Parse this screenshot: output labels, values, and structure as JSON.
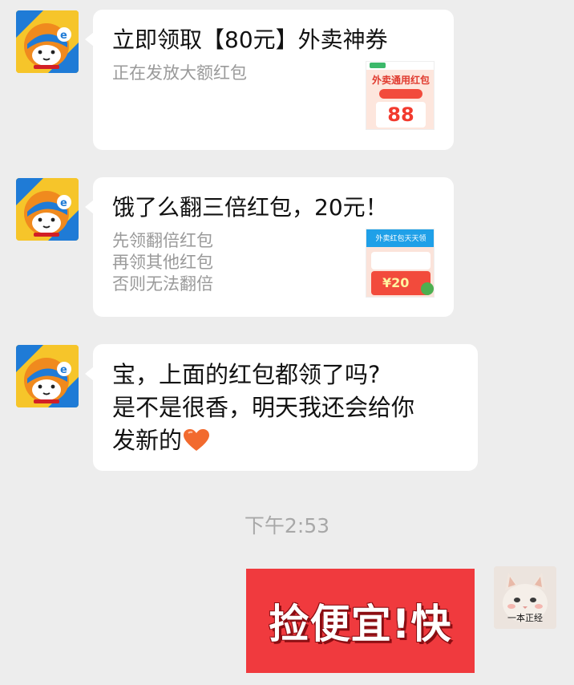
{
  "messages": [
    {
      "type": "card",
      "title": "立即领取【80元】外卖神券",
      "desc_lines": [
        "正在发放大额红包"
      ],
      "thumb": {
        "headline": "外卖通用红包",
        "amount": "88"
      }
    },
    {
      "type": "card",
      "title": "饿了么翻三倍红包，20元！",
      "desc_lines": [
        "先领翻倍红包",
        "再领其他红包",
        "否则无法翻倍"
      ],
      "thumb": {
        "headline": "外卖红包天天领",
        "amount": "¥20"
      }
    },
    {
      "type": "text",
      "lines": [
        "宝，上面的红包都领了吗?",
        "是不是很香，明天我还会给你",
        "发新的"
      ]
    }
  ],
  "timestamp": "下午2:53",
  "my_message": {
    "sticker_text": "捡便宜!快"
  },
  "my_avatar": {
    "caption": "一本正经"
  },
  "colors": {
    "background": "#ededed",
    "bubble": "#ffffff",
    "sticker_red": "#f03a3e",
    "avatar_blue": "#1f7bd6",
    "avatar_yellow": "#f6c52a",
    "heart": "#f26a2e"
  },
  "icons": {
    "contact_avatar": "cartoon-dog-helmet-icon",
    "heart": "heart-icon",
    "my_avatar": "cat-photo-icon"
  }
}
